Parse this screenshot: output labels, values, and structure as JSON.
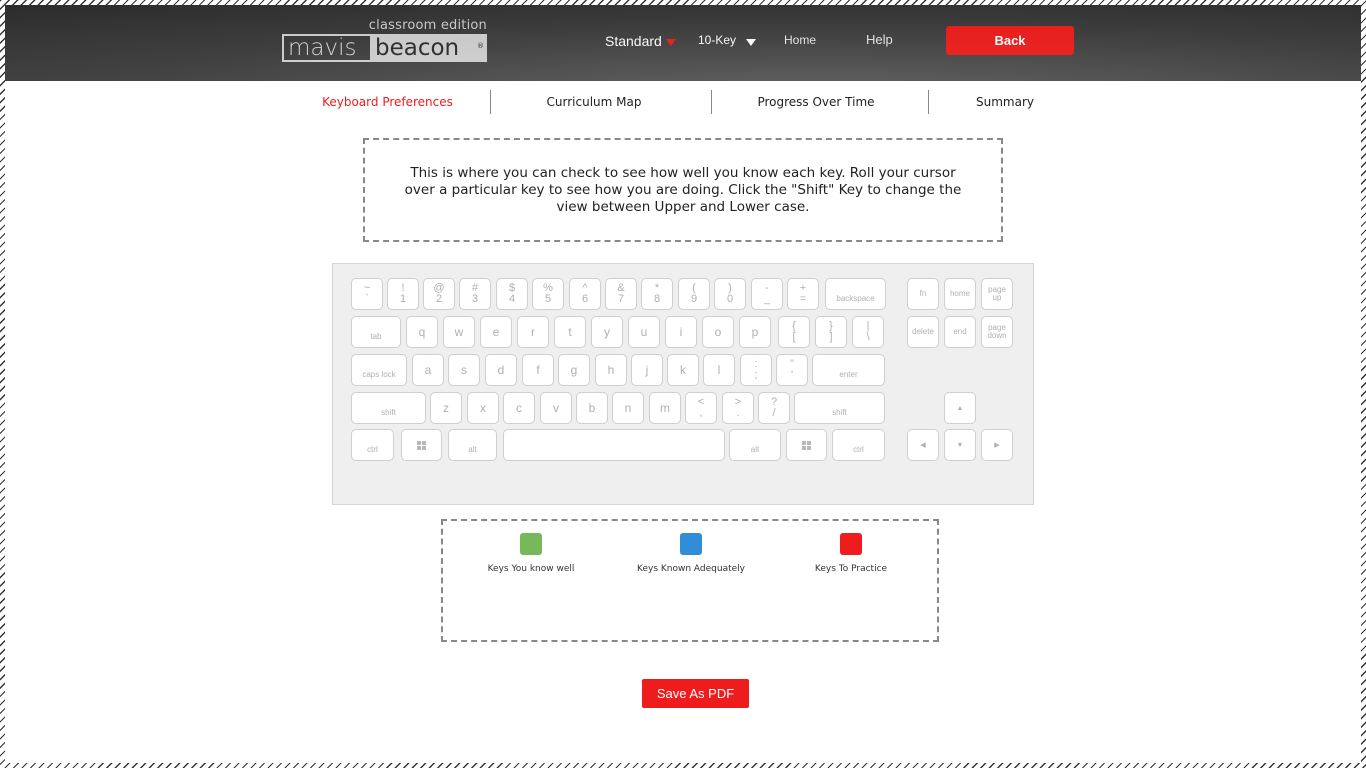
{
  "header": {
    "logo": {
      "edition": "classroom edition",
      "word1": "mavis",
      "word2": "beacon",
      "reg": "®"
    },
    "nav": {
      "standard": "Standard",
      "tenkey": "10-Key",
      "home": "Home",
      "help": "Help",
      "back": "Back"
    }
  },
  "tabs": [
    {
      "label": "Keyboard Preferences",
      "active": true
    },
    {
      "label": "Curriculum Map",
      "active": false
    },
    {
      "label": "Progress Over Time",
      "active": false
    },
    {
      "label": "Summary",
      "active": false
    }
  ],
  "info": {
    "text": "This is where you can check to see how well you know each key. Roll your cursor over a particular key to see how you are doing. Click the \"Shift\" Key to change the view between Upper and Lower case."
  },
  "keyboard": {
    "row1": [
      {
        "top": "~",
        "bot": "`"
      },
      {
        "top": "!",
        "bot": "1"
      },
      {
        "top": "@",
        "bot": "2"
      },
      {
        "top": "#",
        "bot": "3"
      },
      {
        "top": "$",
        "bot": "4"
      },
      {
        "top": "%",
        "bot": "5"
      },
      {
        "top": "^",
        "bot": "6"
      },
      {
        "top": "&",
        "bot": "7"
      },
      {
        "top": "*",
        "bot": "8"
      },
      {
        "top": "(",
        "bot": "9"
      },
      {
        "top": ")",
        "bot": "0"
      },
      {
        "top": "-",
        "bot": "_"
      },
      {
        "top": "+",
        "bot": "="
      }
    ],
    "backspace": "backspace",
    "tab": "tab",
    "row2": [
      "q",
      "w",
      "e",
      "r",
      "t",
      "y",
      "u",
      "i",
      "o",
      "p"
    ],
    "row2_sym": [
      {
        "top": "{",
        "bot": "["
      },
      {
        "top": "}",
        "bot": "]"
      },
      {
        "top": "|",
        "bot": "\\"
      }
    ],
    "capslock": "caps lock",
    "row3": [
      "a",
      "s",
      "d",
      "f",
      "g",
      "h",
      "j",
      "k",
      "l"
    ],
    "row3_sym": [
      {
        "top": ":",
        "bot": ";"
      },
      {
        "top": "\"",
        "bot": "'"
      }
    ],
    "enter": "enter",
    "shift": "shift",
    "row4": [
      "z",
      "x",
      "c",
      "v",
      "b",
      "n",
      "m"
    ],
    "row4_sym": [
      {
        "top": "<",
        "bot": ","
      },
      {
        "top": ">",
        "bot": "."
      },
      {
        "top": "?",
        "bot": "/"
      }
    ],
    "ctrl": "ctrl",
    "alt": "alt",
    "nav_keys": {
      "fn": "fn",
      "home": "home",
      "page_up": "page up",
      "delete": "delete",
      "end": "end",
      "page_down": "page down",
      "up": "▲",
      "left": "◀",
      "down": "▼",
      "right": "▶"
    }
  },
  "legend": [
    {
      "label": "Keys You know well",
      "color": "#77b85a"
    },
    {
      "label": "Keys Known Adequately",
      "color": "#338cd8"
    },
    {
      "label": "Keys To Practice",
      "color": "#ee1c1c"
    }
  ],
  "save_pdf": "Save As PDF"
}
